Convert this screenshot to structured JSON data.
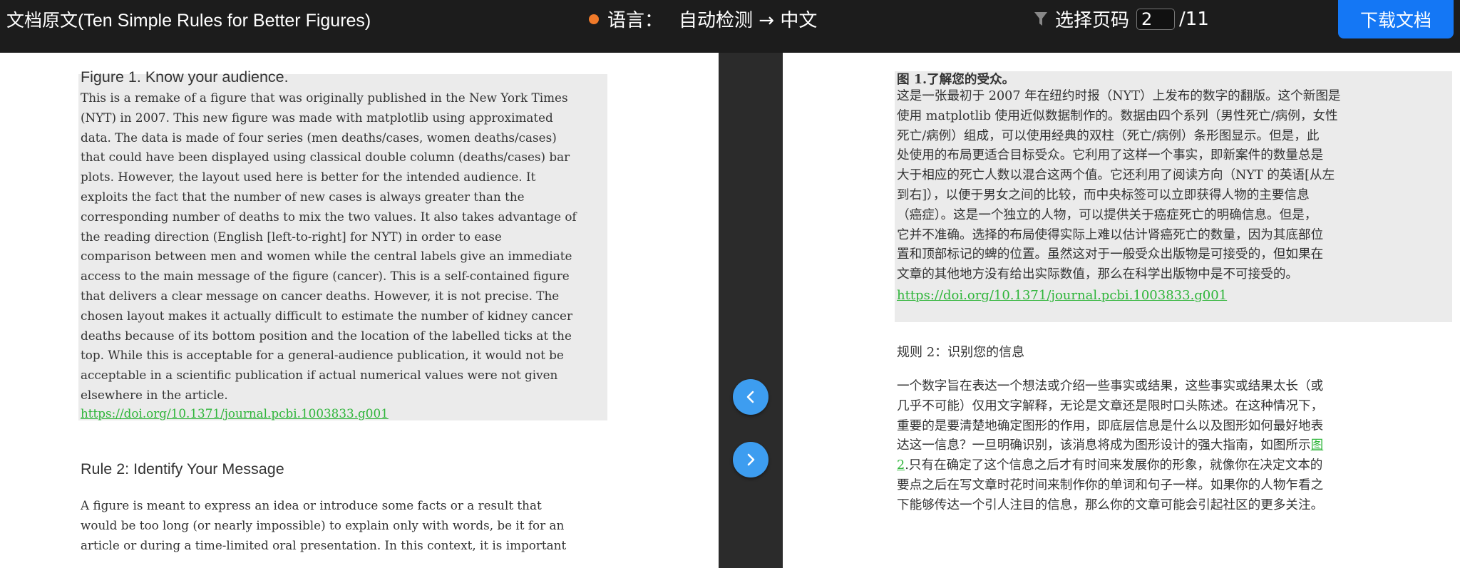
{
  "header": {
    "title": "文档原文(Ten Simple Rules for Better Figures)",
    "language_label": "语言：",
    "language_value": "自动检测 → 中文",
    "page_select_label": "选择页码",
    "current_page": "2",
    "total_pages": "/11",
    "download_label": "下载文档"
  },
  "original": {
    "figure_caption": "Figure 1. Know your audience.",
    "figure_lines": [
      "This is a remake of a figure that was originally published in the New York Times",
      "(NYT) in 2007. This new figure was made with matplotlib using approximated",
      "data. The data is made of four series (men deaths/cases, women deaths/cases)",
      "that could have been displayed using classical double column (deaths/cases) bar",
      "plots. However, the layout used here is better for the intended audience. It",
      "exploits the fact that the number of new cases is always greater than the",
      "corresponding number of deaths to mix the two values. It also takes advantage of",
      "the reading direction (English [left-to-right] for NYT) in order to ease",
      "comparison between men and women while the central labels give an immediate",
      "access to the main message of the figure (cancer). This is a self-contained figure",
      "that delivers a clear message on cancer deaths. However, it is not precise. The",
      "chosen layout makes it actually difficult to estimate the number of kidney cancer",
      "deaths because of its bottom position and the location of the labelled ticks at the",
      "top. While this is acceptable for a general-audience publication, it would not be",
      "acceptable in a scientific publication if actual numerical values were not given",
      "elsewhere in the article."
    ],
    "figure_link": "https://doi.org/10.1371/journal.pcbi.1003833.g001",
    "rule_heading": "Rule 2: Identify Your Message",
    "rule_lines": [
      "A figure is meant to express an idea or introduce some facts or a result that",
      "would be too long (or nearly impossible) to explain only with words, be it for an",
      "article or during a time-limited oral presentation. In this context, it is important"
    ]
  },
  "translation": {
    "figure_caption": "图 1.了解您的受众。",
    "figure_lines": [
      "这是一张最初于 2007 年在纽约时报（NYT）上发布的数字的翻版。这个新图是",
      "使用 matplotlib 使用近似数据制作的。数据由四个系列（男性死亡/病例，女性",
      "死亡/病例）组成，可以使用经典的双柱（死亡/病例）条形图显示。但是，此",
      "处使用的布局更适合目标受众。它利用了这样一个事实，即新案件的数量总是",
      "大于相应的死亡人数以混合这两个值。它还利用了阅读方向（NYT 的英语[从左",
      "到右]），以便于男女之间的比较，而中央标签可以立即获得人物的主要信息",
      "（癌症）。这是一个独立的人物，可以提供关于癌症死亡的明确信息。但是，",
      "它并不准确。选择的布局使得实际上难以估计肾癌死亡的数量，因为其底部位",
      "置和顶部标记的蜱的位置。虽然这对于一般受众出版物是可接受的，但如果在",
      "文章的其他地方没有给出实际数值，那么在科学出版物中是不可接受的。"
    ],
    "figure_link": "https://doi.org/10.1371/journal.pcbi.1003833.g001",
    "rule_heading": "规则 2：识别您的信息",
    "rule_lines": [
      "一个数字旨在表达一个想法或介绍一些事实或结果，这些事实或结果太长（或",
      "几乎不可能）仅用文字解释，无论是文章还是限时口头陈述。在这种情况下，",
      "重要的是要清楚地确定图形的作用，即底层信息是什么以及图形如何最好地表",
      "达这一信息？一旦明确识别，该消息将成为图形设计的强大指南，如图所示"
    ],
    "fig_ref_a": "图",
    "fig_ref_b": "2",
    "rule_line5_rest": ".只有在确定了这个信息之后才有时间来发展你的形象，就像你在决定文本的",
    "rule_lines_tail": [
      "要点之后在写文章时花时间来制作你的单词和句子一样。如果你的人物乍看之",
      "下能够传达一个引人注目的信息，那么你的文章可能会引起社区的更多关注。"
    ]
  },
  "colors": {
    "accent": "#1477f5",
    "link": "#2fb53a",
    "status_dot": "#f07a2a",
    "nav_button": "#3d9df0"
  }
}
